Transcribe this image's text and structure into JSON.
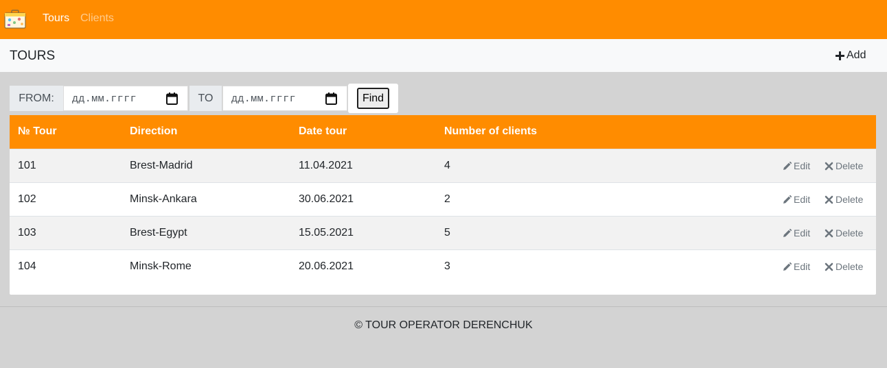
{
  "nav": {
    "logo_icon": "suitcase-logo",
    "links": [
      {
        "label": "Tours",
        "active": true
      },
      {
        "label": "Clients",
        "active": false
      }
    ]
  },
  "header": {
    "title": "TOURS",
    "add_label": "Add"
  },
  "filter": {
    "from_label": "FROM:",
    "from_placeholder": "дд.мм.гггг",
    "to_label": "TO",
    "to_placeholder": "дд.мм.гггг",
    "find_label": "Find"
  },
  "table": {
    "columns": [
      "№ Tour",
      "Direction",
      "Date tour",
      "Number of clients"
    ],
    "rows": [
      {
        "number": "101",
        "direction": "Brest-Madrid",
        "date": "11.04.2021",
        "clients": "4"
      },
      {
        "number": "102",
        "direction": "Minsk-Ankara",
        "date": "30.06.2021",
        "clients": "2"
      },
      {
        "number": "103",
        "direction": "Brest-Egypt",
        "date": "15.05.2021",
        "clients": "5"
      },
      {
        "number": "104",
        "direction": "Minsk-Rome",
        "date": "20.06.2021",
        "clients": "3"
      }
    ],
    "edit_label": "Edit",
    "delete_label": "Delete"
  },
  "footer": {
    "text": "© TOUR OPERATOR DERENCHUK"
  },
  "colors": {
    "brand": "#ff8c00",
    "background": "#d3d3d3",
    "header_bg": "#f8f9fa"
  }
}
